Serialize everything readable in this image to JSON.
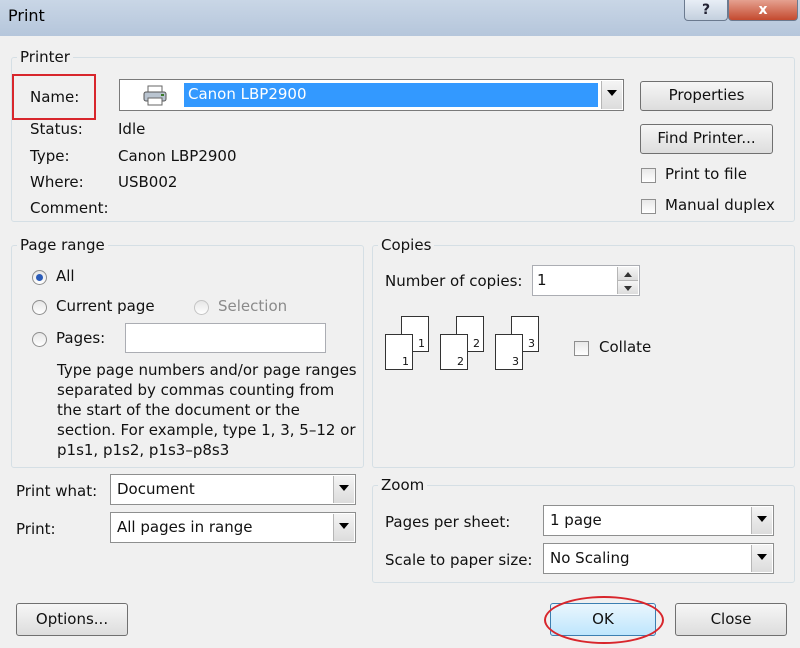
{
  "window": {
    "title": "Print",
    "help_glyph": "?",
    "close_glyph": "x"
  },
  "printer": {
    "group_label": "Printer",
    "name_label": "Name:",
    "name_value": "Canon LBP2900",
    "status_label": "Status:",
    "status_value": "Idle",
    "type_label": "Type:",
    "type_value": "Canon LBP2900",
    "where_label": "Where:",
    "where_value": "USB002",
    "comment_label": "Comment:",
    "properties_label": "Properties",
    "find_printer_label": "Find Printer...",
    "print_to_file_label": "Print to file",
    "manual_duplex_label": "Manual duplex"
  },
  "page_range": {
    "group_label": "Page range",
    "all_label": "All",
    "current_page_label": "Current page",
    "selection_label": "Selection",
    "pages_label": "Pages:",
    "pages_value": "",
    "help_text": "Type page numbers and/or page ranges separated by commas counting from the start of the document or the section. For example, type 1, 3, 5–12 or p1s1, p1s2, p1s3–p8s3"
  },
  "copies": {
    "group_label": "Copies",
    "number_label": "Number of copies:",
    "number_value": "1",
    "collate_label": "Collate",
    "collate_pages": [
      {
        "back": "1",
        "front": "1"
      },
      {
        "back": "2",
        "front": "2"
      },
      {
        "back": "3",
        "front": "3"
      }
    ]
  },
  "print_what": {
    "label": "Print what:",
    "value": "Document"
  },
  "print": {
    "label": "Print:",
    "value": "All pages in range"
  },
  "zoom": {
    "group_label": "Zoom",
    "pages_per_sheet_label": "Pages per sheet:",
    "pages_per_sheet_value": "1 page",
    "scale_label": "Scale to paper size:",
    "scale_value": "No Scaling"
  },
  "buttons": {
    "options_label": "Options...",
    "ok_label": "OK",
    "close_label": "Close"
  },
  "colors": {
    "highlight": "#3399ff",
    "annotation_red": "#d8262c"
  }
}
